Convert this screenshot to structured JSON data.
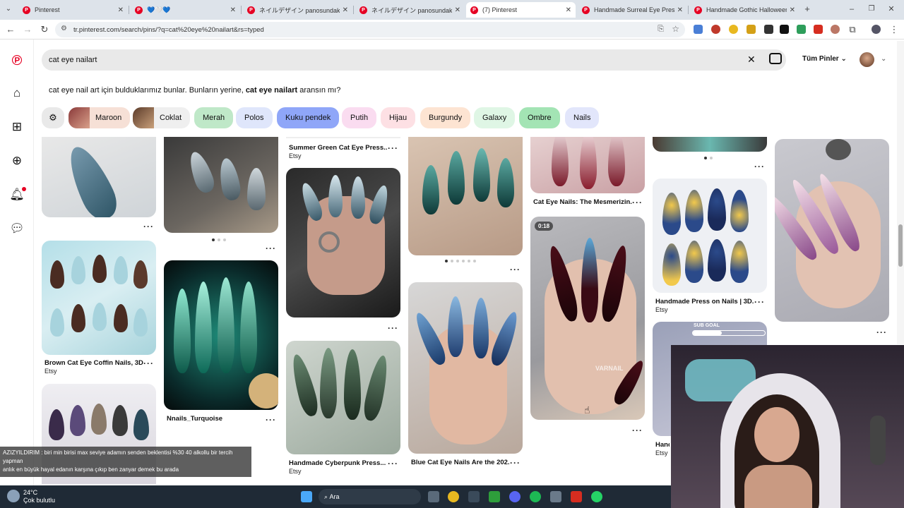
{
  "browser": {
    "tabs": [
      {
        "label": "Pinterest",
        "active": false
      },
      {
        "label": "💙🤍💙",
        "active": false
      },
      {
        "label": "ネイルデザイン panosundaki Pin",
        "active": false
      },
      {
        "label": "ネイルデザイン panosundaki Pin",
        "active": false
      },
      {
        "label": "(7) Pinterest",
        "active": true
      },
      {
        "label": "Handmade Surreal Eye Press O",
        "active": false
      },
      {
        "label": "Handmade Gothic Halloween P",
        "active": false
      }
    ],
    "new_tab": "+",
    "url": "tr.pinterest.com/search/pins/?q=cat%20eye%20nailart&rs=typed"
  },
  "search": {
    "query": "cat eye nailart",
    "filter_label": "Tüm Pinler"
  },
  "suggestion": {
    "prefix": "cat eye nail art için bulduklarımız bunlar. Bunların yerine, ",
    "term": "cat eye nailart",
    "suffix": " aransın mı?"
  },
  "chips": [
    {
      "label": "Maroon",
      "bg": "#f6e0d6"
    },
    {
      "label": "Coklat",
      "bg": "#efefef"
    },
    {
      "label": "Merah",
      "bg": "#bfe8c8"
    },
    {
      "label": "Polos",
      "bg": "#dfe6fb"
    },
    {
      "label": "Kuku pendek",
      "bg": "#8fa6f8"
    },
    {
      "label": "Putih",
      "bg": "#fadcf0"
    },
    {
      "label": "Hijau",
      "bg": "#fde0e4"
    },
    {
      "label": "Burgundy",
      "bg": "#fde4d2"
    },
    {
      "label": "Galaxy",
      "bg": "#dff6e5"
    },
    {
      "label": "Ombre",
      "bg": "#a3e4b4"
    },
    {
      "label": "Nails",
      "bg": "#e2e6fb"
    }
  ],
  "pins": {
    "summer_green": {
      "title": "Summer Green Cat Eye Press...",
      "source": "Etsy"
    },
    "cat_eye_mesmerizing": {
      "title": "Cat Eye Nails: The Mesmerizin..."
    },
    "brown_cat_eye": {
      "title": "Brown Cat Eye Coffin Nails, 3D...",
      "source": "Etsy"
    },
    "nnails_turquoise": {
      "title": "Nnails_Turquoise"
    },
    "handmade_press_on": {
      "title": "Handmade Press on Nails | 3D...",
      "source": "Etsy"
    },
    "handmade_cyberpunk": {
      "title": "Handmade Cyberpunk Press...",
      "source": "Etsy"
    },
    "blue_cat_eye": {
      "title": "Blue Cat Eye Nails Are the 202..."
    },
    "partial_hand": {
      "title": "Hand",
      "source": "Etsy"
    },
    "video_duration": "0:18",
    "watermark": "VARNAIL"
  },
  "overlays": {
    "sub_goal": "SUB GOAL",
    "chat_line1": "AZIZYILDIRIM : biri min birisi max seviye adamın senden beklentisi %30 40 alkollu bir tercih yapman",
    "chat_line2": "anlık en büyük hayal edanın karşına çıkıp ben zanyar demek bu arada"
  },
  "taskbar": {
    "temperature": "24°C",
    "weather": "Çok bulutlu",
    "search_label": "Ara"
  },
  "colors": {
    "pinterest_red": "#e60023",
    "taskbar": "#1f2a36"
  }
}
